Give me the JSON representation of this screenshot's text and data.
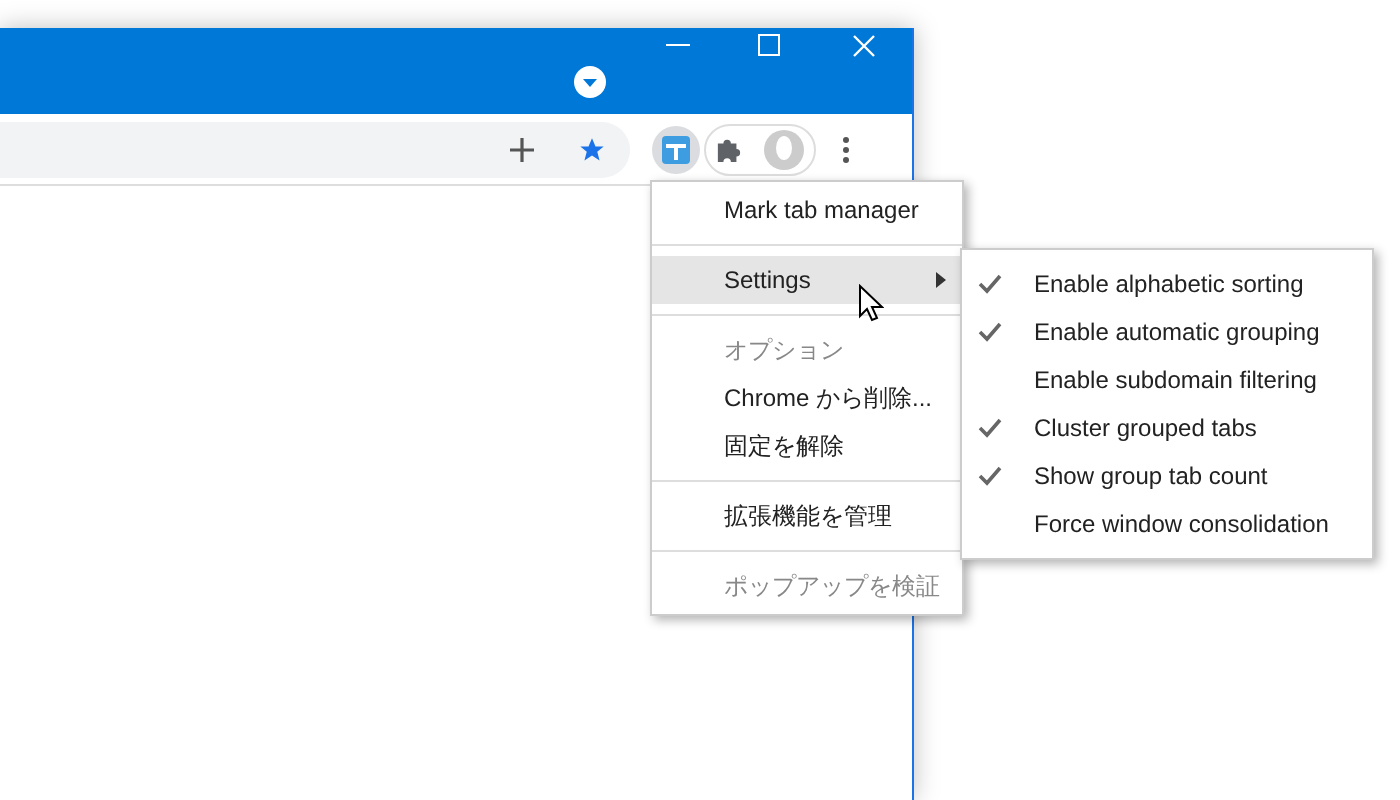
{
  "toolbar": {
    "extension_pressed": true
  },
  "menu": {
    "groups": [
      [
        {
          "label": "Mark tab manager",
          "selected": false,
          "disabled": false,
          "has_submenu": false
        }
      ],
      [
        {
          "label": "Settings",
          "selected": true,
          "disabled": false,
          "has_submenu": true
        }
      ],
      [
        {
          "label": "オプション",
          "selected": false,
          "disabled": true,
          "has_submenu": false
        },
        {
          "label": "Chrome から削除...",
          "selected": false,
          "disabled": false,
          "has_submenu": false
        },
        {
          "label": "固定を解除",
          "selected": false,
          "disabled": false,
          "has_submenu": false
        }
      ],
      [
        {
          "label": "拡張機能を管理",
          "selected": false,
          "disabled": false,
          "has_submenu": false
        }
      ],
      [
        {
          "label": "ポップアップを検証",
          "selected": false,
          "disabled": true,
          "has_submenu": false
        }
      ]
    ]
  },
  "submenu": {
    "items": [
      {
        "label": "Enable alphabetic sorting",
        "checked": true
      },
      {
        "label": "Enable automatic grouping",
        "checked": true
      },
      {
        "label": "Enable subdomain filtering",
        "checked": false
      },
      {
        "label": "Cluster grouped tabs",
        "checked": true
      },
      {
        "label": "Show group tab count",
        "checked": true
      },
      {
        "label": "Force window consolidation",
        "checked": false
      }
    ]
  }
}
